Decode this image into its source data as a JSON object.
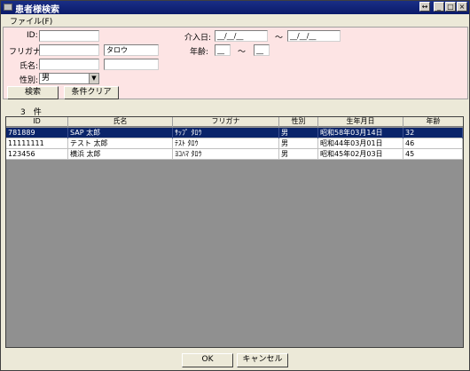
{
  "window": {
    "title": "患者様検索",
    "controls": {
      "minimize": "_",
      "maximize": "□",
      "close": "×",
      "extra": "↔"
    }
  },
  "menu": {
    "file": "ファイル(F)"
  },
  "form": {
    "id_label": "ID:",
    "id_value": "",
    "kana_label": "フリガナ:",
    "kana_last_value": "",
    "kana_first_value": "タロウ",
    "name_label": "氏名:",
    "name_last_value": "",
    "name_first_value": "",
    "sex_label": "性別:",
    "sex_value": "男",
    "admission_label": "介入日:",
    "admission_from": "__/__/__",
    "admission_sep": "〜",
    "admission_to": "__/__/__",
    "age_label": "年齢:",
    "age_from": "__",
    "age_sep": "〜",
    "age_to": "__",
    "search_button": "検索",
    "clear_button": "条件クリア"
  },
  "results": {
    "count_text": "3　件",
    "columns": [
      "ID",
      "氏名",
      "フリガナ",
      "性別",
      "生年月日",
      "年齢"
    ],
    "rows": [
      {
        "id": "781889",
        "name": "SAP 太郎",
        "kana": "ｻｯﾌﾟ ﾀﾛｳ",
        "sex": "男",
        "dob": "昭和58年03月14日",
        "age": "32",
        "selected": true
      },
      {
        "id": "11111111",
        "name": "テスト 太郎",
        "kana": "ﾃｽﾄ ﾀﾛｳ",
        "sex": "男",
        "dob": "昭和44年03月01日",
        "age": "46",
        "selected": false
      },
      {
        "id": "123456",
        "name": "横浜 太郎",
        "kana": "ﾖｺﾊﾏ ﾀﾛｳ",
        "sex": "男",
        "dob": "昭和45年02月03日",
        "age": "45",
        "selected": false
      }
    ]
  },
  "footer": {
    "ok_button": "OK",
    "cancel_button": "キャンセル"
  },
  "colors": {
    "title_bar": "#0a1a6a",
    "search_panel": "#fde4e4",
    "selected_row": "#0a246a",
    "grid_background": "#909090"
  }
}
